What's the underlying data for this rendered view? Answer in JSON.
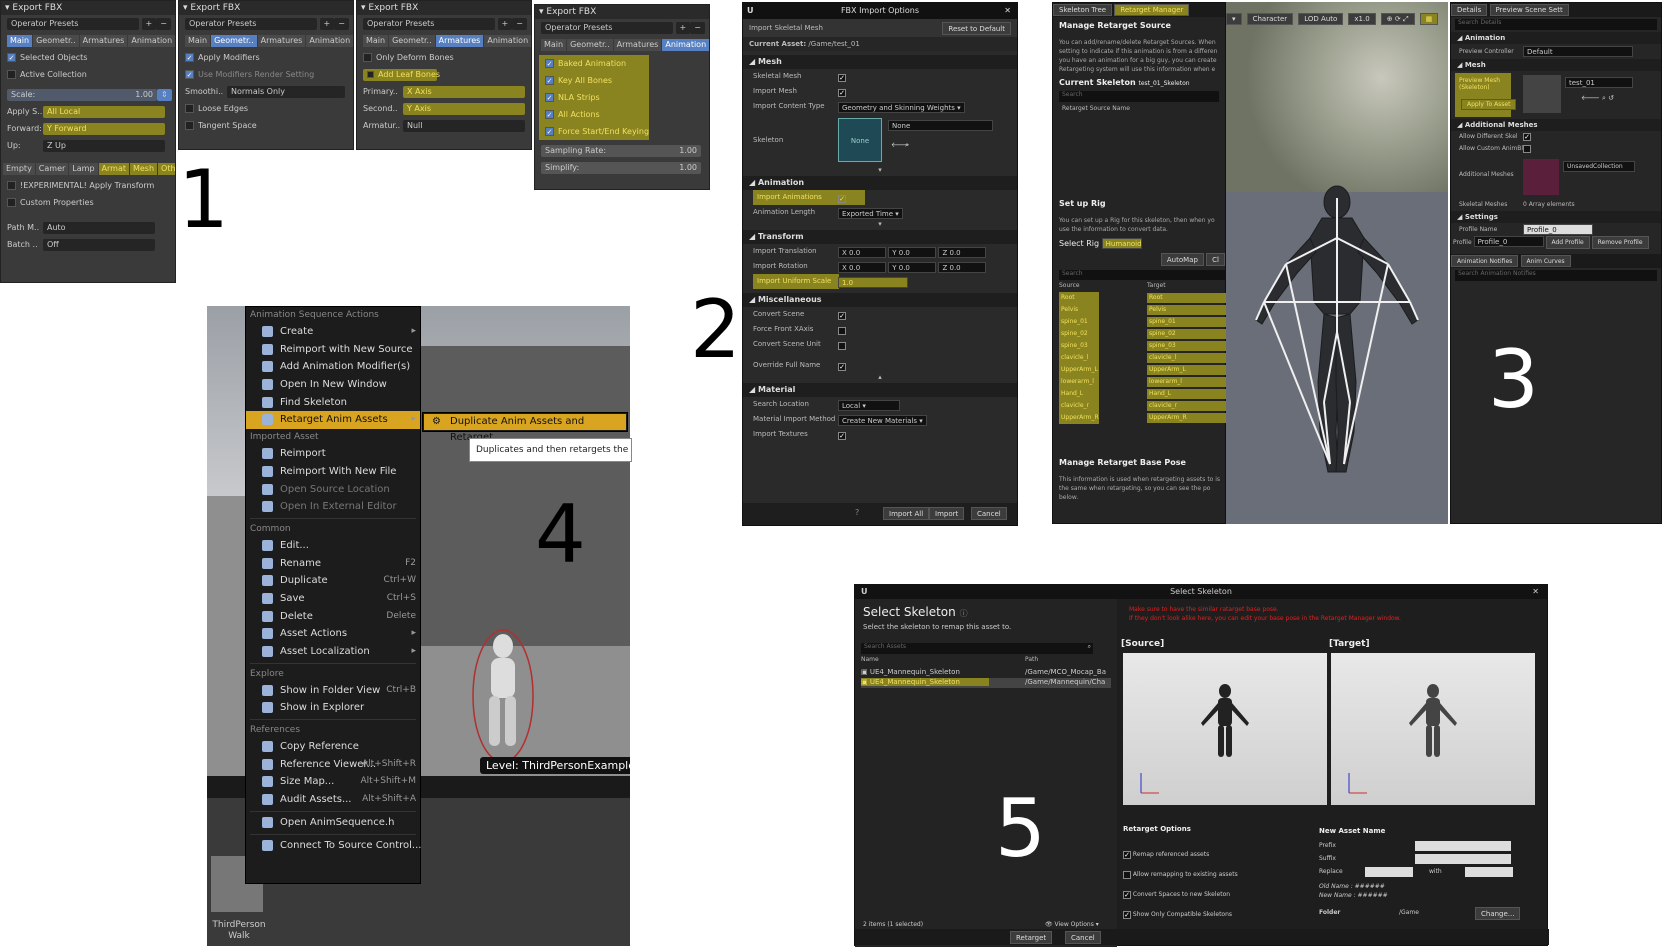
{
  "labels": {
    "n1": "1",
    "n2": "2",
    "n3": "3",
    "n4": "4",
    "n5": "5"
  },
  "blender": {
    "panel1": {
      "title": "Export FBX",
      "preset": "Operator Presets",
      "tabs": [
        "Main",
        "Geometr..",
        "Armatures",
        "Animation"
      ],
      "selected_objects": "Selected Objects",
      "active_collection": "Active Collection",
      "scale_label": "Scale:",
      "scale_value": "1.00",
      "apply_label": "Apply S..",
      "apply_value": "All Local",
      "forward_label": "Forward:",
      "forward_value": "Y Forward",
      "up_label": "Up:",
      "up_value": "Z Up",
      "types": [
        "Empty",
        "Camer",
        "Lamp",
        "Armat",
        "Mesh",
        "Other"
      ],
      "experimental": "!EXPERIMENTAL! Apply Transform",
      "custom_props": "Custom Properties",
      "path_label": "Path M..",
      "path_value": "Auto",
      "batch_label": "Batch ..",
      "batch_value": "Off"
    },
    "panel2": {
      "title": "Export FBX",
      "preset": "Operator Presets",
      "tabs": [
        "Main",
        "Geometr..",
        "Armatures",
        "Animation"
      ],
      "apply_modifiers": "Apply Modifiers",
      "use_modifiers": "Use Modifiers Render Setting",
      "smooth_label": "Smoothi..",
      "smooth_value": "Normals Only",
      "loose_edges": "Loose Edges",
      "tangent_space": "Tangent Space"
    },
    "panel3": {
      "title": "Export FBX",
      "preset": "Operator Presets",
      "tabs": [
        "Main",
        "Geometr..",
        "Armatures",
        "Animation"
      ],
      "only_deform": "Only Deform Bones",
      "add_leaf": "Add Leaf Bones",
      "primary_label": "Primary..",
      "primary_value": "X Axis",
      "second_label": "Second..",
      "second_value": "Y Axis",
      "armature_label": "Armatur..",
      "armature_value": "Null"
    },
    "panel4": {
      "title": "Export FBX",
      "preset": "Operator Presets",
      "tabs": [
        "Main",
        "Geometr..",
        "Armatures",
        "Animation"
      ],
      "baked": "Baked Animation",
      "key_all": "Key All Bones",
      "nla": "NLA Strips",
      "all_actions": "All Actions",
      "force": "Force Start/End Keying",
      "sampling_label": "Sampling Rate:",
      "sampling_value": "1.00",
      "simplify_label": "Simplify:",
      "simplify_value": "1.00"
    }
  },
  "fbx_import": {
    "title": "FBX Import Options",
    "subtitle": "Import Skeletal Mesh",
    "reset": "Reset to Default",
    "current_asset_label": "Current Asset:",
    "current_asset": "/Game/test_01",
    "mesh": "Mesh",
    "skeletal_mesh": "Skeletal Mesh",
    "import_mesh": "Import Mesh",
    "import_content_type": "Import Content Type",
    "content_value": "Geometry and Skinning Weights",
    "skeleton": "Skeleton",
    "skeleton_value": "None",
    "thumb": "None",
    "animation": "Animation",
    "import_animations": "Import Animations",
    "animation_length": "Animation Length",
    "anim_len_value": "Exported Time",
    "transform": "Transform",
    "import_translation": "Import Translation",
    "import_rotation": "Import Rotation",
    "import_uniform_scale": "Import Uniform Scale",
    "scale_value": "1.0",
    "x": "X",
    "y": "Y",
    "z": "Z",
    "zero": "0.0",
    "misc": "Miscellaneous",
    "convert_scene": "Convert Scene",
    "force_front": "Force Front XAxis",
    "convert_scene_unit": "Convert Scene Unit",
    "override_full_name": "Override Full Name",
    "material": "Material",
    "search_location": "Search Location",
    "search_value": "Local",
    "material_method": "Material Import Method",
    "material_value": "Create New Materials",
    "import_textures": "Import Textures",
    "import_all": "Import All",
    "import": "Import",
    "cancel": "Cancel"
  },
  "retarget": {
    "tabs": [
      "Skeleton Tree",
      "Retarget Manager"
    ],
    "toolbar": [
      "Character",
      "LOD Auto",
      "x1.0"
    ],
    "manage_source": "Manage Retarget Source",
    "manage_desc": "You can add/rename/delete Retarget Sources. When setting to indicate if this animation is from a differen you have an animation for a big guy, you can create Retargeting system will use this information when e",
    "current_skeleton_label": "Current Skeleton",
    "current_skeleton": "test_01_Skeleton",
    "search": "Search",
    "retarget_source_name": "Retarget Source Name",
    "setup_rig": "Set up Rig",
    "setup_desc": "You can set up a Rig for this skeleton, then when yo use the information to convert data.",
    "select_rig": "Select Rig",
    "rig_value": "Humanoid",
    "automap": "AutoMap",
    "clear": "Cl",
    "source_col": "Source",
    "target_col": "Target",
    "bones": [
      {
        "s": "Root",
        "t": "Root"
      },
      {
        "s": "Pelvis",
        "t": "Pelvis"
      },
      {
        "s": "spine_01",
        "t": "spine_01"
      },
      {
        "s": "spine_02",
        "t": "spine_02"
      },
      {
        "s": "spine_03",
        "t": "spine_03"
      },
      {
        "s": "clavicle_l",
        "t": "clavicle_l"
      },
      {
        "s": "UpperArm_L",
        "t": "UpperArm_L"
      },
      {
        "s": "lowerarm_l",
        "t": "lowerarm_l"
      },
      {
        "s": "Hand_L",
        "t": "Hand_L"
      },
      {
        "s": "clavicle_r",
        "t": "clavicle_r"
      },
      {
        "s": "UpperArm_R",
        "t": "UpperArm_R"
      }
    ],
    "base_pose": "Manage Retarget Base Pose",
    "base_desc": "This information is used when retargeting assets to is the same when retargeting, so you can see the po below.",
    "details_tabs": [
      "Details",
      "Preview Scene Sett"
    ],
    "search_details": "Search Details",
    "d_animation": "Animation",
    "preview_controller": "Preview Controller",
    "pc_value": "Default",
    "d_mesh": "Mesh",
    "preview_mesh": "Preview Mesh (Skeleton)",
    "apply_to_asset": "Apply To Asset",
    "mesh_value": "test_01",
    "additional_meshes": "Additional Meshes",
    "allow_different": "Allow Different Skel",
    "allow_custom": "Allow Custom AnimBl",
    "additional_label": "Additional Meshes",
    "unsaved": "UnsavedCollection",
    "skeletal_meshes": "Skeletal Meshes",
    "array": "0 Array elements",
    "settings": "Settings",
    "profile_name": "Profile Name",
    "profile_value": "Profile_0",
    "profile": "Profile",
    "add_profile": "Add Profile",
    "remove_profile": "Remove Profile",
    "bottom_tabs": [
      "Animation Notifies",
      "Anim Curves"
    ],
    "search_notifies": "Search Animation Notifies"
  },
  "context": {
    "sec_actions": "Animation Sequence Actions",
    "items1": [
      "Create",
      "Reimport with New Source",
      "Add Animation Modifier(s)",
      "Open In New Window",
      "Find Skeleton",
      "Retarget Anim Assets"
    ],
    "sec_imported": "Imported Asset",
    "items2": [
      "Reimport",
      "Reimport With New File",
      "Open Source Location",
      "Open In External Editor"
    ],
    "sec_common": "Common",
    "items3": [
      {
        "l": "Edit...",
        "k": ""
      },
      {
        "l": "Rename",
        "k": "F2"
      },
      {
        "l": "Duplicate",
        "k": "Ctrl+W"
      },
      {
        "l": "Save",
        "k": "Ctrl+S"
      },
      {
        "l": "Delete",
        "k": "Delete"
      },
      {
        "l": "Asset Actions",
        "k": ""
      },
      {
        "l": "Asset Localization",
        "k": ""
      }
    ],
    "sec_explore": "Explore",
    "items4": [
      {
        "l": "Show in Folder View",
        "k": "Ctrl+B"
      },
      {
        "l": "Show in Explorer",
        "k": ""
      }
    ],
    "sec_refs": "References",
    "items5": [
      {
        "l": "Copy Reference",
        "k": ""
      },
      {
        "l": "Reference Viewer...",
        "k": "Alt+Shift+R"
      },
      {
        "l": "Size Map...",
        "k": "Alt+Shift+M"
      },
      {
        "l": "Audit Assets...",
        "k": "Alt+Shift+A"
      }
    ],
    "open_h": "Open AnimSequence.h",
    "connect": "Connect To Source Control...",
    "sub": "Duplicate Anim Assets and Retarget",
    "tooltip": "Duplicates and then retargets the se",
    "level_label": "Level:",
    "level": "ThirdPersonExampleMap",
    "thumb_label": "ThirdPerson Walk"
  },
  "select_skeleton": {
    "window_title": "Select Skeleton",
    "heading": "Select Skeleton",
    "desc": "Select the skeleton to remap this asset to.",
    "search": "Search Assets",
    "name_col": "Name",
    "path_col": "Path",
    "rows": [
      {
        "n": "UE4_Mannequin_Skeleton",
        "p": "/Game/MCO_Mocap_Ba"
      },
      {
        "n": "UE4_Mannequin_Skeleton",
        "p": "/Game/Mannequin/Cha"
      }
    ],
    "warn1": "Make sure to have the similar ratarget base pose.",
    "warn2": "If they don't look alike here, you can edit your base pose in the Retarget Manager window.",
    "source": "[Source]",
    "target": "[Target]",
    "retarget_options": "Retarget Options",
    "opt1": "Remap referenced assets",
    "opt2": "Allow remapping to existing assets",
    "opt3": "Convert Spaces to new Skeleton",
    "opt4": "Show Only Compatible Skeletons",
    "new_asset_name": "New Asset Name",
    "prefix": "Prefix",
    "suffix": "Suffix",
    "replace": "Replace",
    "with": "with",
    "old_name": "Old Name : ######",
    "new_name": "New Name : ######",
    "folder": "Folder",
    "folder_value": "/Game",
    "change": "Change...",
    "items_count": "2 items (1 selected)",
    "view_options": "View Options",
    "retarget_btn": "Retarget",
    "cancel_btn": "Cancel"
  }
}
